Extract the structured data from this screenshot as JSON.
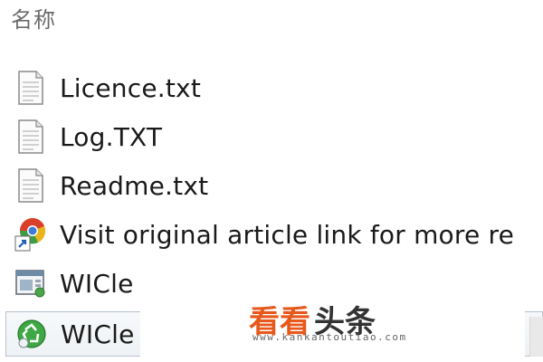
{
  "header": {
    "name_column_label": "名称"
  },
  "files": [
    {
      "name": "Licence.txt",
      "icon": "text-document-icon"
    },
    {
      "name": "Log.TXT",
      "icon": "text-document-icon"
    },
    {
      "name": "Readme.txt",
      "icon": "text-document-icon"
    },
    {
      "name": "Visit original article link for more re",
      "icon": "browser-shortcut-icon"
    },
    {
      "name": "WICle",
      "icon": "application-window-icon"
    },
    {
      "name": "WICle",
      "icon": "recycle-app-icon"
    }
  ],
  "watermark": {
    "title_part1": "看看",
    "title_part2": "头条",
    "url": "www.kankantoutiao.com"
  },
  "colors": {
    "watermark_orange": "#e8581b",
    "selection_border": "#b8c2cc",
    "header_text": "#6b6b6b"
  }
}
